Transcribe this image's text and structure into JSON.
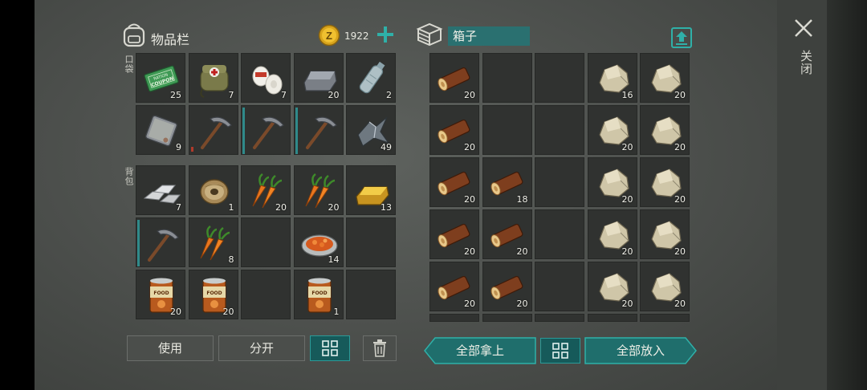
{
  "inventory": {
    "title": "物品栏",
    "coins": "1922",
    "pocket_label": "口袋",
    "backpack_label": "背包",
    "pocket": [
      {
        "item": "ration-coupon",
        "count": "25"
      },
      {
        "item": "first-aid-kit",
        "count": "7"
      },
      {
        "item": "bandage",
        "count": "7"
      },
      {
        "item": "iron-ingot",
        "count": "20"
      },
      {
        "item": "water-bottle",
        "count": "2"
      },
      {
        "item": "metal-plate",
        "count": "9"
      },
      {
        "item": "pickaxe",
        "count": ""
      },
      {
        "item": "pickaxe",
        "count": ""
      },
      {
        "item": "pickaxe",
        "count": ""
      },
      {
        "item": "scrap-metal",
        "count": "49"
      }
    ],
    "backpack": [
      {
        "item": "aluminum-bars",
        "count": "7"
      },
      {
        "item": "wire-spool",
        "count": "1"
      },
      {
        "item": "carrots",
        "count": "20"
      },
      {
        "item": "carrots",
        "count": "20"
      },
      {
        "item": "gold-bar",
        "count": "13"
      },
      {
        "item": "pickaxe",
        "count": ""
      },
      {
        "item": "carrots",
        "count": "8"
      },
      {
        "item": "",
        "count": ""
      },
      {
        "item": "stew-bowl",
        "count": "14"
      },
      {
        "item": "",
        "count": ""
      },
      {
        "item": "canned-food",
        "count": "20"
      },
      {
        "item": "canned-food",
        "count": "20"
      },
      {
        "item": "",
        "count": ""
      },
      {
        "item": "canned-food",
        "count": "1"
      },
      {
        "item": "",
        "count": ""
      }
    ],
    "buttons": {
      "use": "使用",
      "split": "分开"
    }
  },
  "box": {
    "title": "箱子",
    "grid": [
      {
        "item": "log",
        "count": "20"
      },
      {
        "item": "",
        "count": ""
      },
      {
        "item": "",
        "count": ""
      },
      {
        "item": "stone",
        "count": "16"
      },
      {
        "item": "stone",
        "count": "20"
      },
      {
        "item": "log",
        "count": "20"
      },
      {
        "item": "",
        "count": ""
      },
      {
        "item": "",
        "count": ""
      },
      {
        "item": "stone",
        "count": "20"
      },
      {
        "item": "stone",
        "count": "20"
      },
      {
        "item": "log",
        "count": "20"
      },
      {
        "item": "log",
        "count": "18"
      },
      {
        "item": "",
        "count": ""
      },
      {
        "item": "stone",
        "count": "20"
      },
      {
        "item": "stone",
        "count": "20"
      },
      {
        "item": "log",
        "count": "20"
      },
      {
        "item": "log",
        "count": "20"
      },
      {
        "item": "",
        "count": ""
      },
      {
        "item": "stone",
        "count": "20"
      },
      {
        "item": "stone",
        "count": "20"
      },
      {
        "item": "log",
        "count": "20"
      },
      {
        "item": "log",
        "count": "20"
      },
      {
        "item": "",
        "count": ""
      },
      {
        "item": "stone",
        "count": "20"
      },
      {
        "item": "stone",
        "count": "20"
      }
    ],
    "buttons": {
      "take_all": "全部拿上",
      "put_all": "全部放入"
    }
  },
  "close_label": "关闭",
  "colors": {
    "accent": "#2b9a98",
    "panel": "#4f524f"
  }
}
